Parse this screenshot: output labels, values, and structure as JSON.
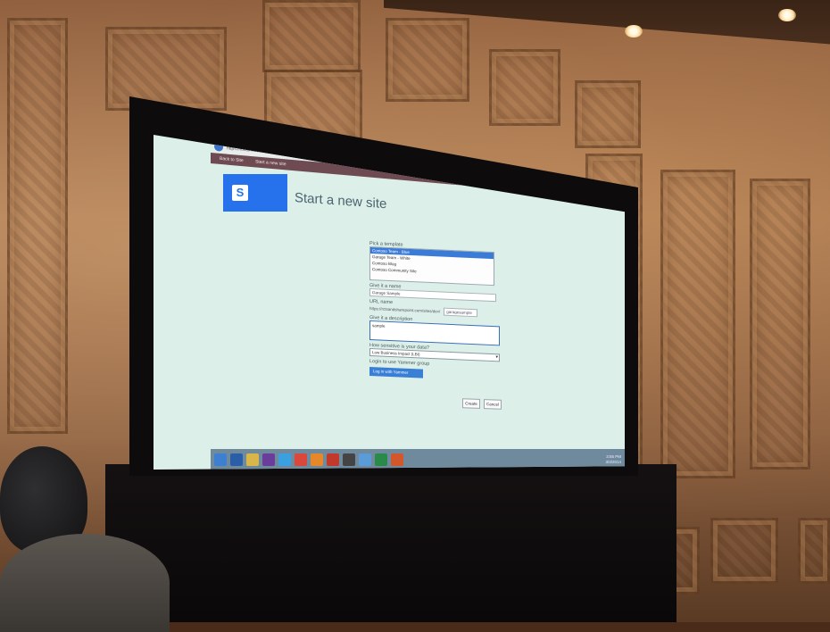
{
  "browser": {
    "url": "https://localhost/..."
  },
  "nav": {
    "back_label": "Back to Site",
    "current_label": "Start a new site"
  },
  "page": {
    "title": "Start a new site"
  },
  "form": {
    "template_label": "Pick a template",
    "templates": [
      "Contoso Team - Blue",
      "Garage Team - White",
      "Contoso Blog",
      "Contoso Community Site"
    ],
    "selected_template_index": 0,
    "name_label": "Give it a name",
    "name_value": "Garage Sample",
    "url_label": "URL name",
    "url_prefix": "https://rctsandsharepoint.com/sites/dev/",
    "url_value": "garagesample",
    "description_label": "Give it a description",
    "description_value": "sample",
    "sensitivity_label": "How sensitive is your data?",
    "sensitivity_value": "Low Business Impact (LBI)",
    "yammer_label": "Login to use Yammer group",
    "yammer_button": "Log in with Yammer",
    "create_button": "Create",
    "cancel_button": "Cancel"
  },
  "taskbar": {
    "clock_time": "3:55 PM",
    "clock_date": "3/3/2014"
  }
}
